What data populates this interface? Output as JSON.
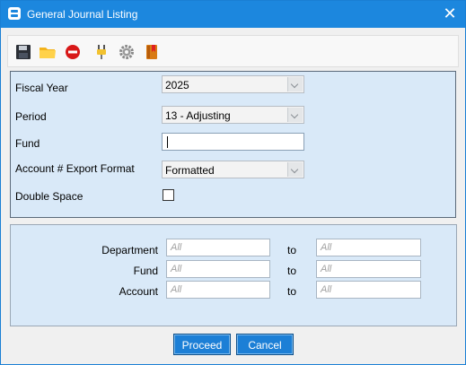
{
  "window": {
    "title": "General Journal Listing"
  },
  "toolbar": {
    "items": [
      {
        "name": "save-icon"
      },
      {
        "name": "open-folder-icon"
      },
      {
        "name": "stop-icon"
      },
      {
        "name": "plug-icon"
      },
      {
        "name": "settings-gear-icon"
      },
      {
        "name": "bookmark-book-icon"
      }
    ]
  },
  "form": {
    "fiscal_year": {
      "label": "Fiscal Year",
      "value": "2025"
    },
    "period": {
      "label": "Period",
      "value": "13 - Adjusting"
    },
    "fund": {
      "label": "Fund",
      "value": ""
    },
    "export_format": {
      "label": "Account # Export Format",
      "value": "Formatted"
    },
    "double_space": {
      "label": "Double Space",
      "checked": false
    }
  },
  "ranges": {
    "to_label": "to",
    "rows": [
      {
        "label": "Department",
        "from_placeholder": "All",
        "to_placeholder": "All"
      },
      {
        "label": "Fund",
        "from_placeholder": "All",
        "to_placeholder": "All"
      },
      {
        "label": "Account",
        "from_placeholder": "All",
        "to_placeholder": "All"
      }
    ]
  },
  "buttons": {
    "proceed": "Proceed",
    "cancel": "Cancel"
  },
  "colors": {
    "titlebar": "#1c87de",
    "panel": "#d9e9f8",
    "button": "#1c7fd6"
  }
}
